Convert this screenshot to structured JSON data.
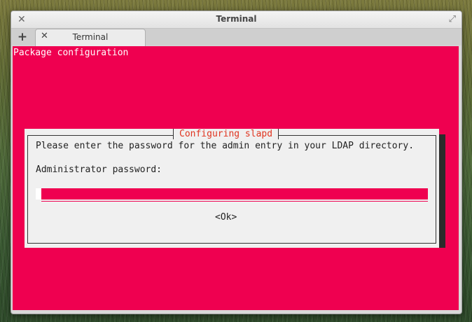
{
  "window": {
    "title": "Terminal",
    "close_icon": "close-icon",
    "maximize_icon": "maximize-icon"
  },
  "tabs": {
    "new_tab_symbol": "+",
    "items": [
      {
        "label": "Terminal",
        "close_symbol": "✕"
      }
    ]
  },
  "terminal": {
    "background_color": "#ef0050",
    "header": "Package configuration",
    "dialog": {
      "title": "Configuring slapd",
      "message": "Please enter the password for the admin entry in your LDAP directory.",
      "password_label": "Administrator password:",
      "password_value": "",
      "ok_label": "<Ok>"
    }
  }
}
